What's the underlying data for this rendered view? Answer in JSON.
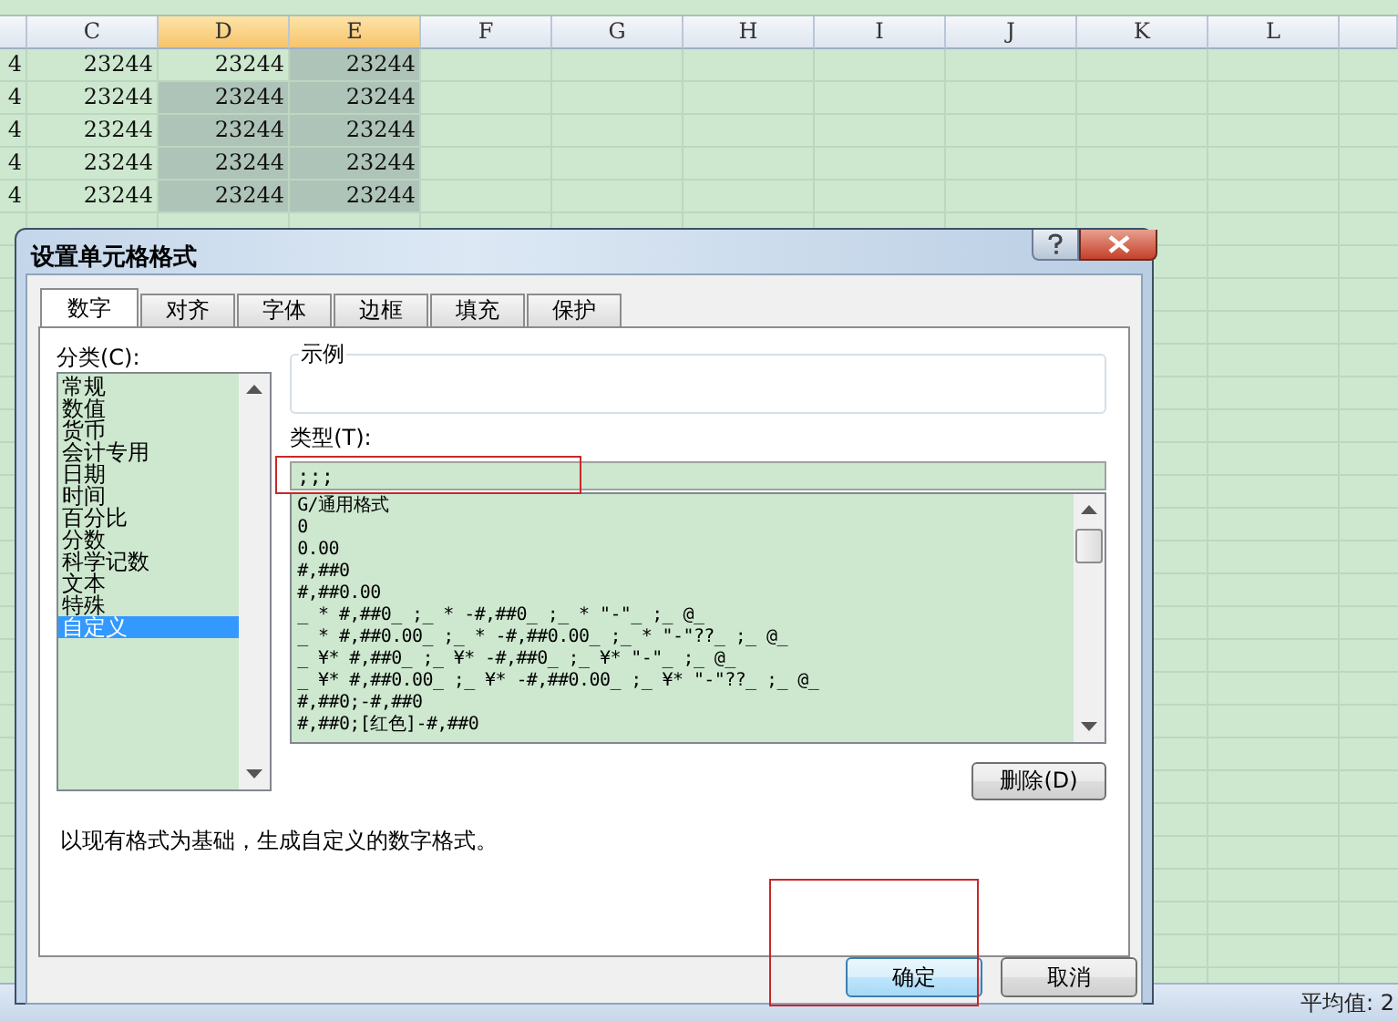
{
  "sheet": {
    "columns": [
      {
        "selected": false
      },
      {
        "label": "C",
        "selected": false
      },
      {
        "label": "D",
        "selected": true
      },
      {
        "label": "E",
        "selected": true
      },
      {
        "label": "F",
        "selected": false
      },
      {
        "label": "G",
        "selected": false
      },
      {
        "label": "H",
        "selected": false
      },
      {
        "label": "I",
        "selected": false
      },
      {
        "label": "J",
        "selected": false
      },
      {
        "label": "K",
        "selected": false
      },
      {
        "label": "L",
        "selected": false
      },
      {
        "selected": false
      }
    ],
    "rows": [
      {
        "cells": [
          {
            "text": "4",
            "selected": false
          },
          {
            "text": "23244",
            "selected": false
          },
          {
            "text": "23244",
            "selected": false
          },
          {
            "text": "23244",
            "selected": true
          }
        ]
      },
      {
        "cells": [
          {
            "text": "4",
            "selected": false
          },
          {
            "text": "23244",
            "selected": false
          },
          {
            "text": "23244",
            "selected": true
          },
          {
            "text": "23244",
            "selected": true
          }
        ]
      },
      {
        "cells": [
          {
            "text": "4",
            "selected": false
          },
          {
            "text": "23244",
            "selected": false
          },
          {
            "text": "23244",
            "selected": true
          },
          {
            "text": "23244",
            "selected": true
          }
        ]
      },
      {
        "cells": [
          {
            "text": "4",
            "selected": false
          },
          {
            "text": "23244",
            "selected": false
          },
          {
            "text": "23244",
            "selected": true
          },
          {
            "text": "23244",
            "selected": true
          }
        ]
      },
      {
        "cells": [
          {
            "text": "4",
            "selected": false
          },
          {
            "text": "23244",
            "selected": false
          },
          {
            "text": "23244",
            "selected": true
          },
          {
            "text": "23244",
            "selected": true
          }
        ]
      }
    ],
    "status_bar": {
      "average": "平均值: 2"
    }
  },
  "dialog": {
    "title": "设置单元格格式",
    "tabs": [
      {
        "label": "数字",
        "selected": true
      },
      {
        "label": "对齐",
        "selected": false
      },
      {
        "label": "字体",
        "selected": false
      },
      {
        "label": "边框",
        "selected": false
      },
      {
        "label": "填充",
        "selected": false
      },
      {
        "label": "保护",
        "selected": false
      }
    ],
    "category_label": "分类(C):",
    "categories": [
      {
        "label": "常规",
        "selected": false
      },
      {
        "label": "数值",
        "selected": false
      },
      {
        "label": "货币",
        "selected": false
      },
      {
        "label": "会计专用",
        "selected": false
      },
      {
        "label": "日期",
        "selected": false
      },
      {
        "label": "时间",
        "selected": false
      },
      {
        "label": "百分比",
        "selected": false
      },
      {
        "label": "分数",
        "selected": false
      },
      {
        "label": "科学记数",
        "selected": false
      },
      {
        "label": "文本",
        "selected": false
      },
      {
        "label": "特殊",
        "selected": false
      },
      {
        "label": "自定义",
        "selected": true
      }
    ],
    "sample_label": "示例",
    "type_label": "类型(T):",
    "type_field": {
      "value": ";;;",
      "highlighted": true
    },
    "formats": [
      "G/通用格式",
      "0",
      "0.00",
      "#,##0",
      "#,##0.00",
      "_ * #,##0_ ;_ * -#,##0_ ;_ * \"-\"_ ;_ @_",
      "_ * #,##0.00_ ;_ * -#,##0.00_ ;_ * \"-\"??_ ;_ @_",
      "_ ¥* #,##0_ ;_ ¥* -#,##0_ ;_ ¥* \"-\"_ ;_ @_",
      "_ ¥* #,##0.00_ ;_ ¥* -#,##0.00_ ;_ ¥* \"-\"??_ ;_ @_",
      "#,##0;-#,##0",
      "#,##0;[红色]-#,##0"
    ],
    "delete_button": "删除(D)",
    "description": "以现有格式为基础，生成自定义的数字格式。",
    "buttons": [
      {
        "label": "确定",
        "kind": "ok",
        "highlighted": true
      },
      {
        "label": "取消",
        "kind": "cancel",
        "highlighted": false
      }
    ]
  }
}
